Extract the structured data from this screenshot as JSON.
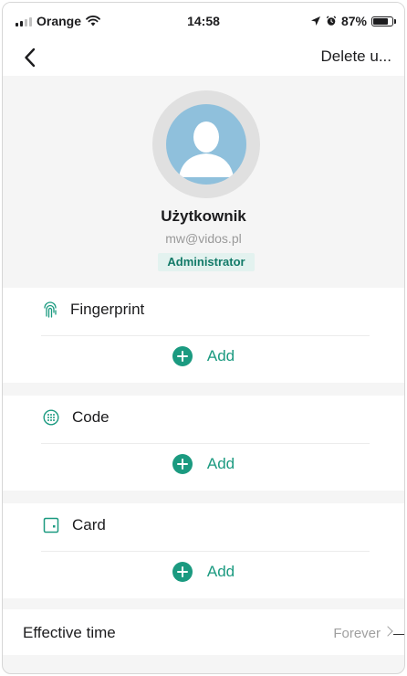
{
  "status_bar": {
    "carrier": "Orange",
    "time": "14:58",
    "battery": "87%",
    "battery_fraction": 0.87,
    "icons": [
      "signal-icon",
      "wifi-icon",
      "location-icon",
      "alarm-icon",
      "battery-icon"
    ]
  },
  "nav": {
    "back_icon": "chevron-left-icon",
    "action_label": "Delete u..."
  },
  "profile": {
    "name": "Użytkownik",
    "email": "mw@vidos.pl",
    "role": "Administrator"
  },
  "credentials": [
    {
      "label": "Fingerprint",
      "icon": "fingerprint-icon",
      "add_label": "Add"
    },
    {
      "label": "Code",
      "icon": "keypad-icon",
      "add_label": "Add"
    },
    {
      "label": "Card",
      "icon": "card-icon",
      "add_label": "Add"
    }
  ],
  "effective_time": {
    "label": "Effective time",
    "value": "Forever"
  },
  "colors": {
    "accent": "#1b9a80",
    "badge_bg": "#e3f2ef",
    "avatar_bg": "#8fc0dc",
    "page_bg": "#f5f5f5"
  }
}
